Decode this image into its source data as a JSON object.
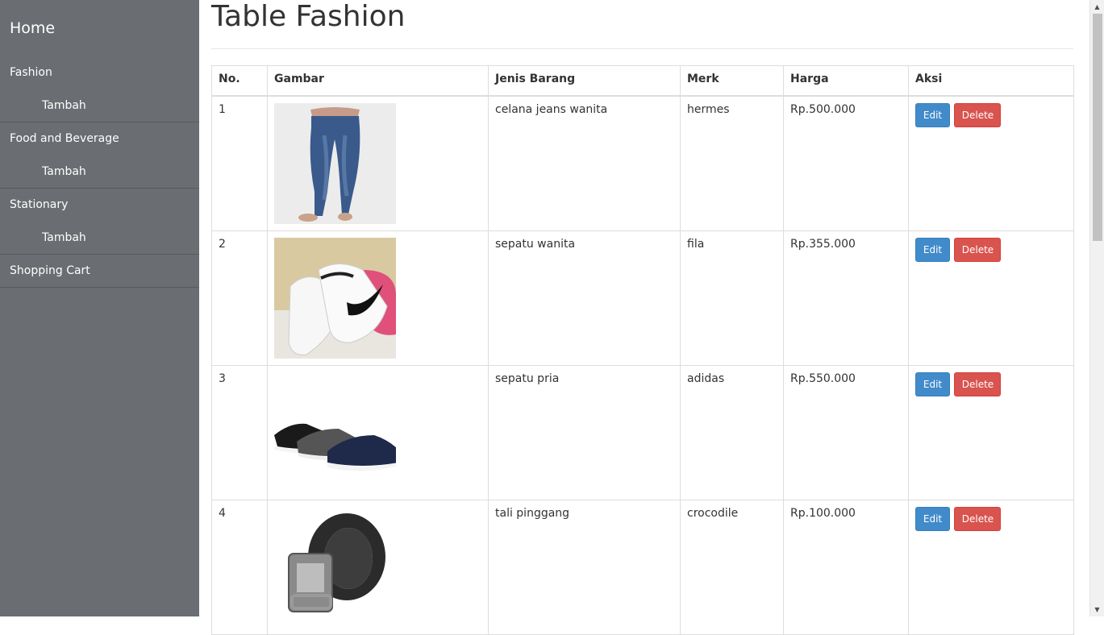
{
  "sidebar": {
    "home": "Home",
    "groups": [
      {
        "label": "Fashion",
        "sub": "Tambah"
      },
      {
        "label": "Food and Beverage",
        "sub": "Tambah"
      },
      {
        "label": "Stationary",
        "sub": "Tambah"
      }
    ],
    "cart": "Shopping Cart"
  },
  "page": {
    "title": "Table Fashion"
  },
  "table": {
    "headers": [
      "No.",
      "Gambar",
      "Jenis Barang",
      "Merk",
      "Harga",
      "Aksi"
    ],
    "rows": [
      {
        "no": "1",
        "jenis": "celana jeans wanita",
        "merk": "hermes",
        "harga": "Rp.500.000",
        "image": "jeans-image"
      },
      {
        "no": "2",
        "jenis": "sepatu wanita",
        "merk": "fila",
        "harga": "Rp.355.000",
        "image": "sneakers-image"
      },
      {
        "no": "3",
        "jenis": "sepatu pria",
        "merk": "adidas",
        "harga": "Rp.550.000",
        "image": "mens-shoes-image"
      },
      {
        "no": "4",
        "jenis": "tali pinggang",
        "merk": "crocodile",
        "harga": "Rp.100.000",
        "image": "belt-image"
      }
    ],
    "edit_label": "Edit",
    "delete_label": "Delete"
  },
  "colors": {
    "sidebar_bg": "#6a6d71",
    "edit_button": "#428bca",
    "delete_button": "#d9534f"
  }
}
